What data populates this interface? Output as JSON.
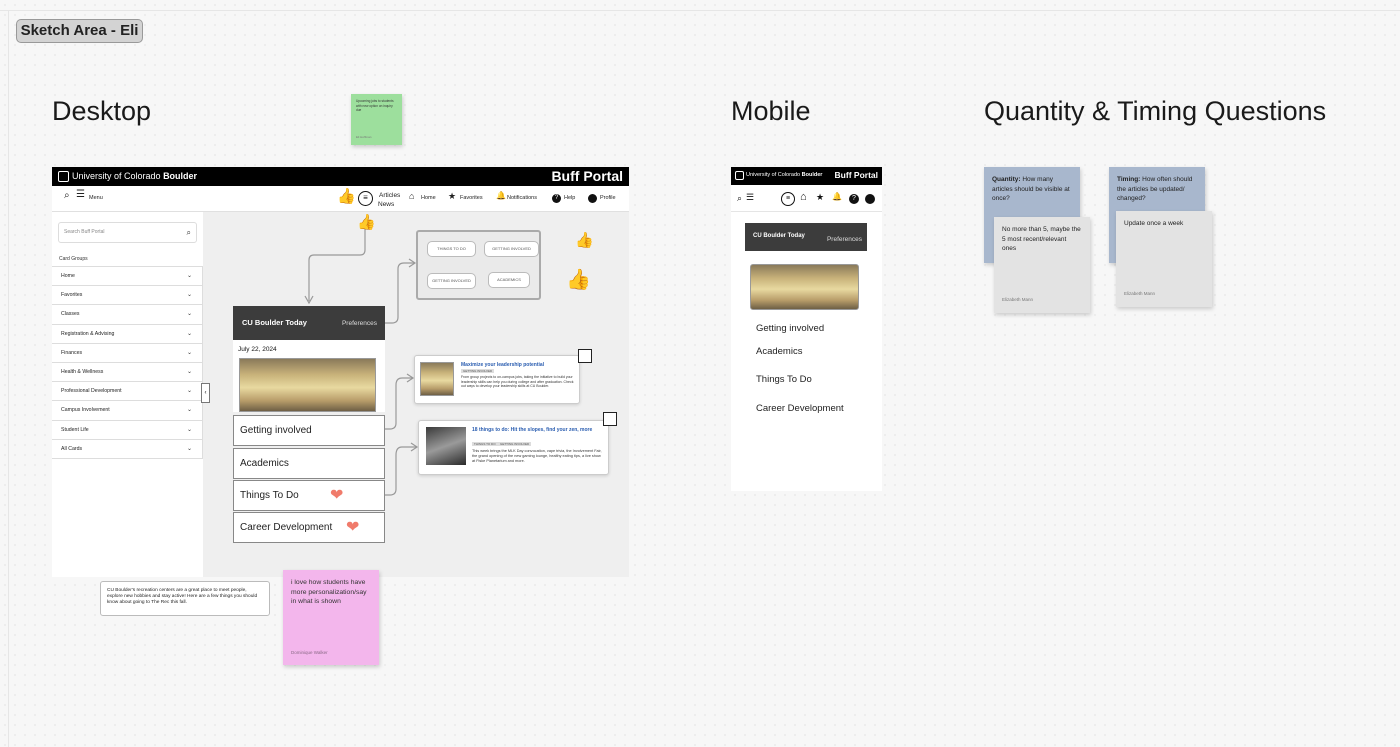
{
  "section_label": "Sketch Area - Eli",
  "headings": {
    "desktop": "Desktop",
    "mobile": "Mobile",
    "quantity": "Quantity & Timing Questions"
  },
  "sticky_green": {
    "text": "Upcoming jobs to students with new option on inquiry due",
    "author": "Eli Hoffman"
  },
  "desktop": {
    "university": "University of Colorado",
    "university_bold": "Boulder",
    "portal_title": "Buff Portal",
    "nav": {
      "menu": "Menu",
      "articles": "Articles",
      "news": "News",
      "home": "Home",
      "favorites": "Favorites",
      "notifications": "Notifications",
      "help": "Help",
      "profile": "Profile"
    },
    "search_placeholder": "Search Buff Portal",
    "card_groups": "Card Groups",
    "sidebar": [
      "Home",
      "Favorites",
      "Classes",
      "Registration & Advising",
      "Finances",
      "Health & Wellness",
      "Professional Development",
      "Campus Involvement",
      "Student Life",
      "All Cards"
    ],
    "cu_today": "CU Boulder Today",
    "preferences": "Preferences",
    "date": "July 22, 2024",
    "categories": [
      "Getting involved",
      "Academics",
      "Things To Do",
      "Career Development"
    ],
    "tags": [
      "THINGS TO DO",
      "GETTING INVOLVED",
      "GETTING INVOLVED",
      "ACADEMICS"
    ],
    "article1": {
      "title": "Maximize your leadership potential",
      "tag": "GETTING INVOLVED",
      "text": "From group projects to on-campus jobs, taking the initiative to build your leadership skills can help you during college and after graduation. Check out ways to develop your leadership skills at CU Boulder."
    },
    "article2": {
      "title": "18 things to do: Hit the slopes, find your zen, more",
      "tags": [
        "THINGS TO DO",
        "GETTING INVOLVED"
      ],
      "text": "This week brings the MLK Day convocation, vape trivia, the Involvement Fair, the grand opening of the new gaming lounge, healthy eating tips, a live show at Fiske Planetarium and more."
    }
  },
  "comment_white": "CU Boulder's recreation centers are a great place to meet people, explore new hobbies and stay active! Here are a few things you should know about going to The Rec this fall.",
  "sticky_pink": {
    "text": "i love how students have more personalization/say in what is shown",
    "author": "Dominique Walker"
  },
  "mobile": {
    "university": "University of Colorado",
    "university_bold": "Boulder",
    "portal_title": "Buff Portal",
    "cu_today": "CU Boulder Today",
    "preferences": "Preferences",
    "categories": [
      "Getting involved",
      "Academics",
      "Things To Do",
      "Career Development"
    ]
  },
  "notes": {
    "q_label": "Quantity:",
    "q_text": "How many articles should be visible at once?",
    "q_answer": "No more than 5, maybe the 5 most recent/relevant ones",
    "q_author": "Elizabeth Mann",
    "t_label": "Timing:",
    "t_text": "How often should the articles be updated/ changed?",
    "t_answer": "Update once a week",
    "t_author": "Elizabeth Mann"
  }
}
